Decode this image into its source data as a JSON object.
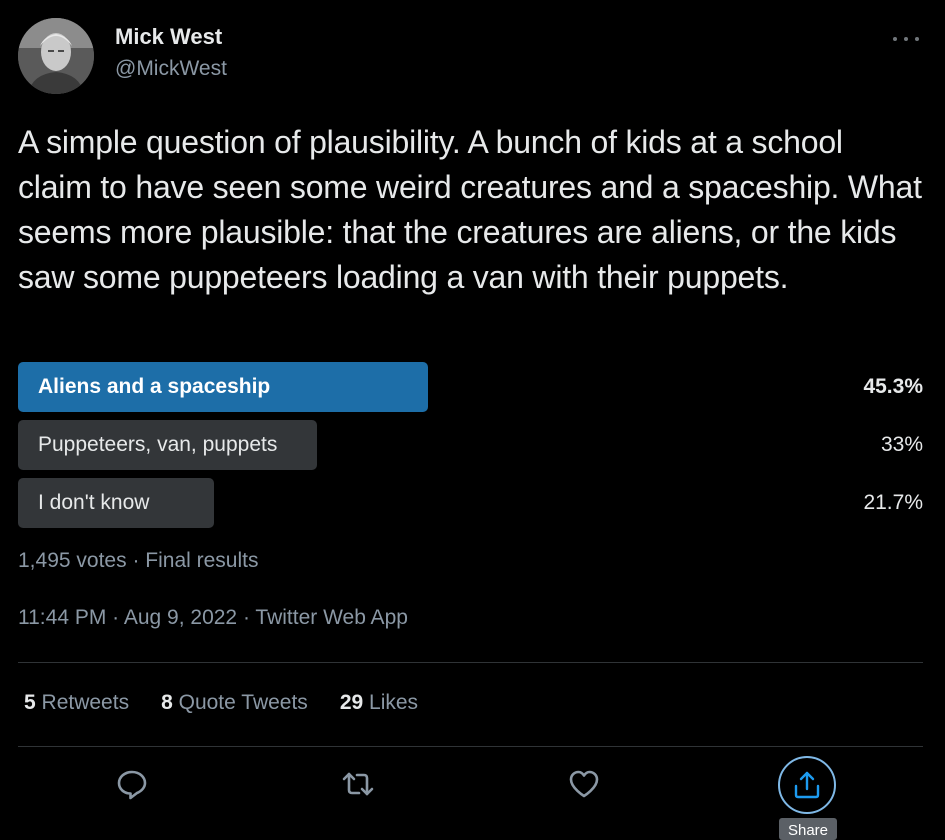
{
  "author": {
    "display_name": "Mick West",
    "handle": "@MickWest",
    "avatar_icon": "user-avatar"
  },
  "tweet": {
    "text": "A simple question of plausibility. A bunch of kids at a school claim to have seen some weird creatures and a spaceship. What seems more plausible: that the creatures are aliens, or the kids saw some puppeteers loading a van with their puppets."
  },
  "poll": {
    "options": [
      {
        "label": "Aliens and a spaceship",
        "percent": "45.3%",
        "value": 45.3,
        "winner": true
      },
      {
        "label": "Puppeteers, van, puppets",
        "percent": "33%",
        "value": 33,
        "winner": false
      },
      {
        "label": "I don't know",
        "percent": "21.7%",
        "value": 21.7,
        "winner": false
      }
    ],
    "votes": "1,495 votes",
    "status": "Final results"
  },
  "meta": {
    "time": "11:44 PM",
    "date": "Aug 9, 2022",
    "source": "Twitter Web App"
  },
  "stats": {
    "retweets_count": "5",
    "retweets_label": "Retweets",
    "quotes_count": "8",
    "quotes_label": "Quote Tweets",
    "likes_count": "29",
    "likes_label": "Likes"
  },
  "actions": {
    "reply_icon": "reply-icon",
    "retweet_icon": "retweet-icon",
    "like_icon": "heart-icon",
    "share_icon": "share-icon",
    "share_tooltip": "Share"
  },
  "colors": {
    "background": "#000000",
    "winner_bar": "#1d6ea8",
    "other_bar": "#333639",
    "share_ring": "#7fb8e6",
    "secondary_text": "#8b98a5"
  }
}
